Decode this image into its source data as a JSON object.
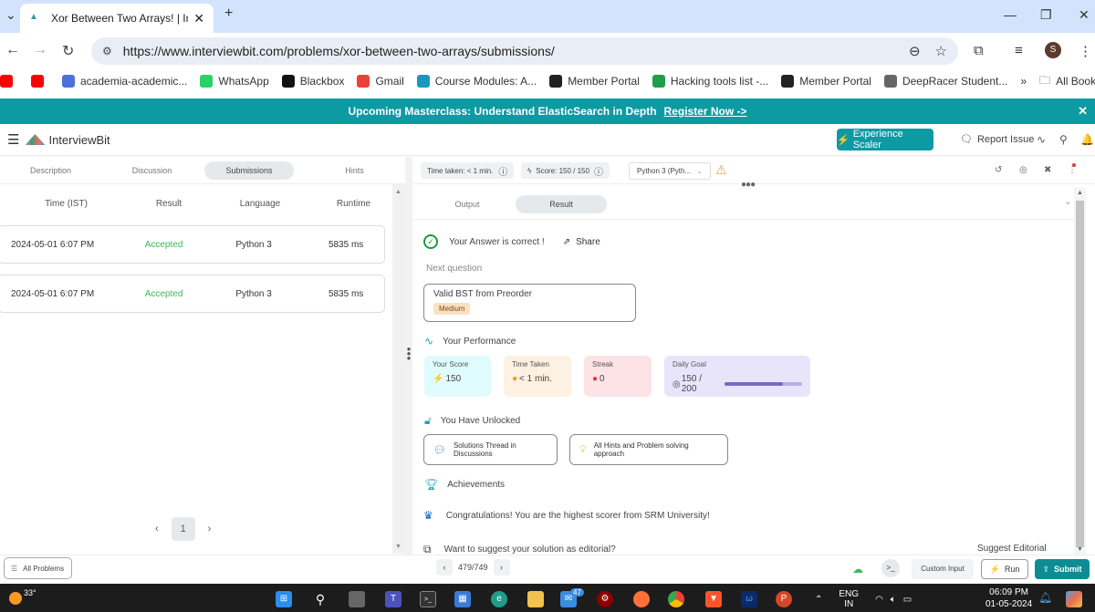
{
  "browser": {
    "tab_title": "Xor Between Two Arrays! | Inter",
    "url": "https://www.interviewbit.com/problems/xor-between-two-arrays/submissions/",
    "profile_initial": "S",
    "bookmarks": [
      {
        "label": "",
        "icon": "youtube-icon",
        "color": "#ff0000"
      },
      {
        "label": "",
        "icon": "youtube-icon",
        "color": "#ff0000"
      },
      {
        "label": "academia-academic...",
        "icon": "academia-icon",
        "color": "#4f6fde"
      },
      {
        "label": "WhatsApp",
        "icon": "whatsapp-icon",
        "color": "#25d366"
      },
      {
        "label": "Blackbox",
        "icon": "blackbox-icon",
        "color": "#111111"
      },
      {
        "label": "Gmail",
        "icon": "gmail-icon",
        "color": "#ea4335"
      },
      {
        "label": "Course Modules: A...",
        "icon": "salesforce-icon",
        "color": "#1798c1"
      },
      {
        "label": "Member Portal",
        "icon": "member-portal-icon",
        "color": "#222222"
      },
      {
        "label": "Hacking tools list -...",
        "icon": "sheets-icon",
        "color": "#1e9e4a"
      },
      {
        "label": "Member Portal",
        "icon": "member-portal-icon",
        "color": "#222222"
      },
      {
        "label": "DeepRacer Student...",
        "icon": "deepracer-icon",
        "color": "#666666"
      }
    ],
    "overflow_label": "»",
    "all_bookmarks": "All Bookmarks"
  },
  "banner": {
    "text": "Upcoming Masterclass: Understand ElasticSearch in Depth",
    "link": "Register Now ->"
  },
  "header": {
    "brand": "InterviewBit",
    "experience_btn": "Experience Scaler",
    "report_issue": "Report Issue"
  },
  "left": {
    "tabs": [
      {
        "label": "Description",
        "active": false
      },
      {
        "label": "Discussion",
        "active": false
      },
      {
        "label": "Submissions",
        "active": true
      },
      {
        "label": "Hints",
        "active": false
      }
    ],
    "columns": [
      "Time (IST)",
      "Result",
      "Language",
      "Runtime"
    ],
    "rows": [
      {
        "time": "2024-05-01 6:07 PM",
        "result": "Accepted",
        "language": "Python 3",
        "runtime": "5835 ms"
      },
      {
        "time": "2024-05-01 6:07 PM",
        "result": "Accepted",
        "language": "Python 3",
        "runtime": "5835 ms"
      }
    ],
    "page": "1"
  },
  "toolbar": {
    "time_taken": "Time taken: < 1 min.",
    "score": "Score: 150 / 150",
    "language": "Python 3 (Pyth..."
  },
  "result": {
    "tabs": [
      {
        "label": "Output",
        "active": false
      },
      {
        "label": "Result",
        "active": true
      }
    ],
    "correct_msg": "Your Answer is correct !",
    "share": "Share",
    "next_question_label": "Next question",
    "next_question": {
      "title": "Valid BST from Preorder",
      "difficulty": "Medium"
    },
    "performance_title": "Your Performance",
    "performance": {
      "score_label": "Your Score",
      "score": "150",
      "time_label": "Time Taken",
      "time": "< 1 min.",
      "streak_label": "Streak",
      "streak": "0",
      "goal_label": "Daily Goal",
      "goal": "150 / 200",
      "goal_fraction": 0.75
    },
    "unlocked_title": "You Have Unlocked",
    "unlocked": [
      "Solutions Thread in Discussions",
      "All Hints and Problem solving approach"
    ],
    "achievements_title": "Achievements",
    "congrats": "Congratulations! You are the highest scorer from SRM University!",
    "editorial_prompt": "Want to suggest your solution as editorial?",
    "suggest_editorial": "Suggest Editorial"
  },
  "bottom": {
    "all_problems": "All Problems",
    "problem_position": "479/749",
    "custom_input": "Custom Input",
    "run": "Run",
    "submit": "Submit"
  },
  "taskbar": {
    "temperature": "33°",
    "mail_badge": "47",
    "lang": "ENG",
    "region": "IN",
    "time": "06:09 PM",
    "date": "01-05-2024"
  }
}
